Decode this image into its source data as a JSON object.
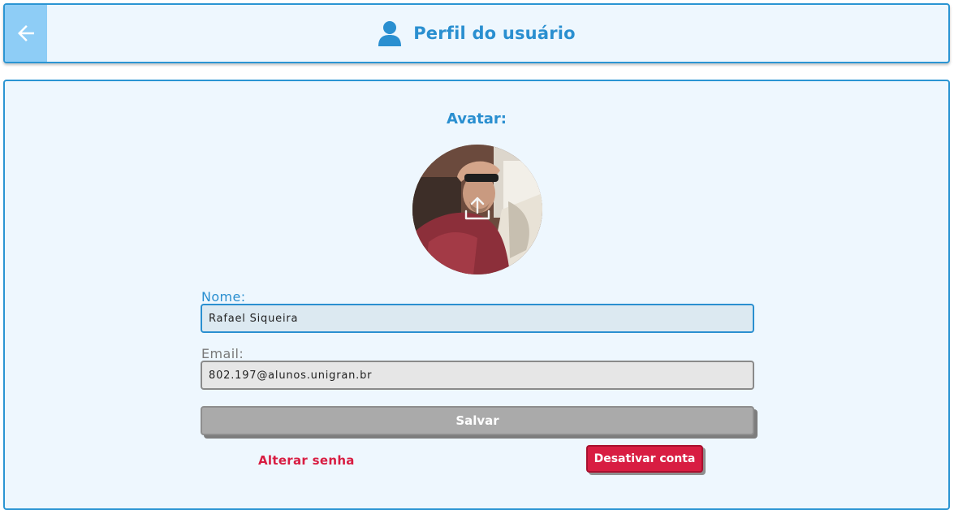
{
  "header": {
    "back_icon": "arrow-left-icon",
    "user_icon": "user-icon",
    "title": "Perfil do usuário"
  },
  "avatar": {
    "label": "Avatar:",
    "upload_icon": "upload-icon"
  },
  "form": {
    "name_label": "Nome:",
    "name_value": "Rafael Siqueira",
    "email_label": "Email:",
    "email_value": "802.197@alunos.unigran.br",
    "save_label": "Salvar"
  },
  "actions": {
    "change_password": "Alterar senha",
    "deactivate": "Desativar conta"
  },
  "colors": {
    "accent": "#2a8fd0",
    "panel_bg": "#eef7fe",
    "danger": "#d81d42",
    "save_bg": "#aaaaaa"
  }
}
